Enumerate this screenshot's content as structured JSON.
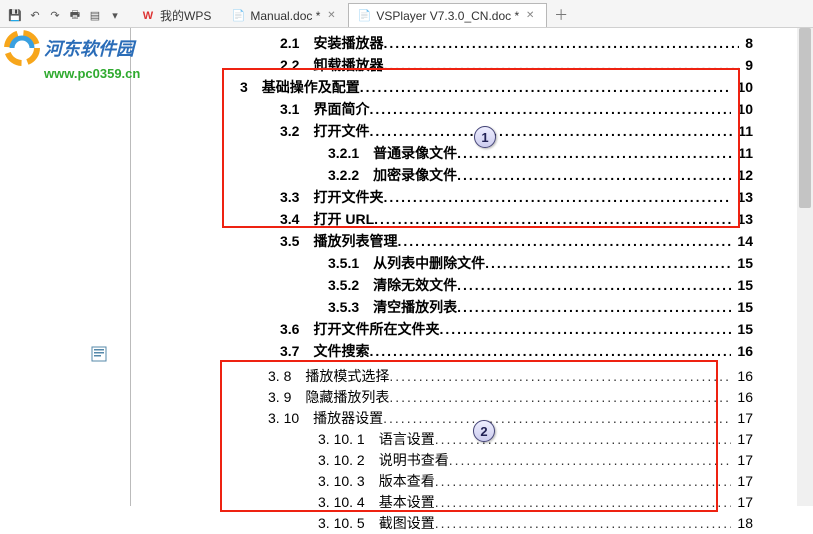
{
  "tabs": [
    {
      "label": "我的WPS"
    },
    {
      "label": "Manual.doc *"
    },
    {
      "label": "VSPlayer V7.3.0_CN.doc *"
    }
  ],
  "watermark": {
    "site": "河东软件园",
    "url": "www.pc0359.cn"
  },
  "toc1": [
    {
      "lvl": 1,
      "num": "2.1",
      "txt": "安装播放器",
      "pg": "8"
    },
    {
      "lvl": 1,
      "num": "2.2",
      "txt": "卸载播放器",
      "pg": "9"
    },
    {
      "lvl": 0,
      "num": "3",
      "txt": "基础操作及配置",
      "pg": "10"
    },
    {
      "lvl": 1,
      "num": "3.1",
      "txt": "界面简介",
      "pg": "10"
    },
    {
      "lvl": 1,
      "num": "3.2",
      "txt": "打开文件",
      "pg": "11"
    },
    {
      "lvl": 2,
      "num": "3.2.1",
      "txt": "普通录像文件",
      "pg": "11"
    },
    {
      "lvl": 2,
      "num": "3.2.2",
      "txt": "加密录像文件",
      "pg": "12"
    },
    {
      "lvl": 1,
      "num": "3.3",
      "txt": "打开文件夹",
      "pg": "13"
    },
    {
      "lvl": 1,
      "num": "3.4",
      "txt": "打开 URL",
      "pg": "13"
    },
    {
      "lvl": 1,
      "num": "3.5",
      "txt": "播放列表管理",
      "pg": "14"
    },
    {
      "lvl": 2,
      "num": "3.5.1",
      "txt": "从列表中删除文件",
      "pg": "15"
    },
    {
      "lvl": 2,
      "num": "3.5.2",
      "txt": "清除无效文件",
      "pg": "15"
    },
    {
      "lvl": 2,
      "num": "3.5.3",
      "txt": "清空播放列表",
      "pg": "15"
    },
    {
      "lvl": 1,
      "num": "3.6",
      "txt": "打开文件所在文件夹",
      "pg": "15"
    },
    {
      "lvl": 1,
      "num": "3.7",
      "txt": "文件搜索",
      "pg": "16"
    }
  ],
  "toc2": [
    {
      "lvl": 1,
      "num": "3. 8",
      "txt": "播放模式选择",
      "pg": "16"
    },
    {
      "lvl": 1,
      "num": "3. 9",
      "txt": "隐藏播放列表",
      "pg": "16"
    },
    {
      "lvl": 1,
      "num": "3. 10",
      "txt": "播放器设置",
      "pg": "17"
    },
    {
      "lvl": 2,
      "num": "3. 10. 1",
      "txt": "语言设置",
      "pg": "17"
    },
    {
      "lvl": 2,
      "num": "3. 10. 2",
      "txt": "说明书查看",
      "pg": "17"
    },
    {
      "lvl": 2,
      "num": "3. 10. 3",
      "txt": "版本查看",
      "pg": "17"
    },
    {
      "lvl": 2,
      "num": "3. 10. 4",
      "txt": "基本设置",
      "pg": "17"
    },
    {
      "lvl": 2,
      "num": "3. 10. 5",
      "txt": "截图设置",
      "pg": "18"
    }
  ],
  "badges": {
    "b1": "1",
    "b2": "2"
  }
}
